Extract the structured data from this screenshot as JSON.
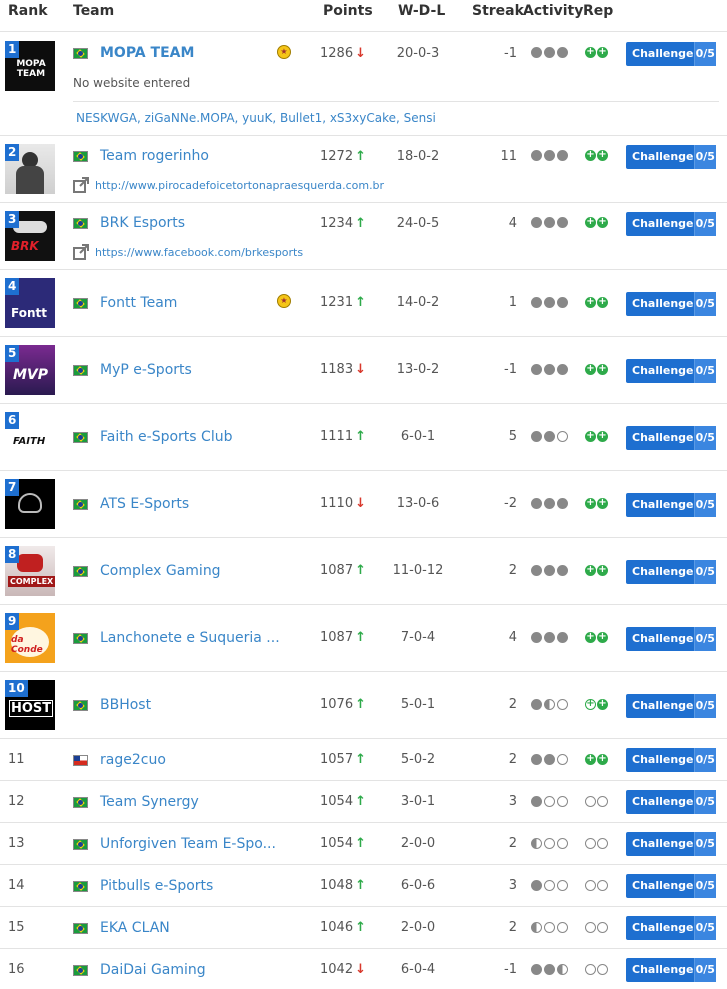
{
  "header": {
    "rank": "Rank",
    "team": "Team",
    "points": "Points",
    "wdl": "W-D-L",
    "streak": "Streak",
    "activity": "Activity",
    "rep": "Rep"
  },
  "challenge": {
    "label": "Challenge",
    "slots": "0/5"
  },
  "teams": [
    {
      "rank": "1",
      "name": "MOPA TEAM",
      "points": "1286",
      "trend": "down",
      "wdl": "20-0-3",
      "streak": "-1",
      "sub": "No website entered",
      "members": "NESKWGA, ziGaNNe.MOPA, yuuK, Bullet1, xS3xyCake, Sensi",
      "medal": true,
      "logo": "MOPA TEAM"
    },
    {
      "rank": "2",
      "name": "Team rogerinho",
      "points": "1272",
      "trend": "up",
      "wdl": "18-0-2",
      "streak": "11",
      "link": "http://www.pirocadefoicetortonapraesquerda.com.br"
    },
    {
      "rank": "3",
      "name": "BRK Esports",
      "points": "1234",
      "trend": "up",
      "wdl": "24-0-5",
      "streak": "4",
      "link": "https://www.facebook.com/brkesports",
      "logo": "BRK"
    },
    {
      "rank": "4",
      "name": "Fontt Team",
      "points": "1231",
      "trend": "up",
      "wdl": "14-0-2",
      "streak": "1",
      "medal": true,
      "logo": "Fontt"
    },
    {
      "rank": "5",
      "name": "MyP e-Sports",
      "points": "1183",
      "trend": "down",
      "wdl": "13-0-2",
      "streak": "-1",
      "logo": "MVP"
    },
    {
      "rank": "6",
      "name": "Faith e-Sports Club",
      "points": "1111",
      "trend": "up",
      "wdl": "6-0-1",
      "streak": "5",
      "logo": "FAITH"
    },
    {
      "rank": "7",
      "name": "ATS E-Sports",
      "points": "1110",
      "trend": "down",
      "wdl": "13-0-6",
      "streak": "-2"
    },
    {
      "rank": "8",
      "name": "Complex Gaming",
      "points": "1087",
      "trend": "up",
      "wdl": "11-0-12",
      "streak": "2",
      "logo": "COMPLEX"
    },
    {
      "rank": "9",
      "name": "Lanchonete e Suqueria ...",
      "points": "1087",
      "trend": "up",
      "wdl": "7-0-4",
      "streak": "4",
      "logo": "da Conde"
    },
    {
      "rank": "10",
      "name": "BBHost",
      "points": "1076",
      "trend": "up",
      "wdl": "5-0-1",
      "streak": "2",
      "logo": "HOST"
    },
    {
      "rank": "11",
      "name": "rage2cuo",
      "points": "1057",
      "trend": "up",
      "wdl": "5-0-2",
      "streak": "2"
    },
    {
      "rank": "12",
      "name": "Team Synergy",
      "points": "1054",
      "trend": "up",
      "wdl": "3-0-1",
      "streak": "3"
    },
    {
      "rank": "13",
      "name": "Unforgiven Team E-Spo...",
      "points": "1054",
      "trend": "up",
      "wdl": "2-0-0",
      "streak": "2"
    },
    {
      "rank": "14",
      "name": "Pitbulls e-Sports",
      "points": "1048",
      "trend": "up",
      "wdl": "6-0-6",
      "streak": "3"
    },
    {
      "rank": "15",
      "name": "EKA CLAN",
      "points": "1046",
      "trend": "up",
      "wdl": "2-0-0",
      "streak": "2"
    },
    {
      "rank": "16",
      "name": "DaiDai Gaming",
      "points": "1042",
      "trend": "down",
      "wdl": "6-0-4",
      "streak": "-1"
    }
  ],
  "icons": {
    "trend_up": "arrow-up-icon",
    "trend_down": "arrow-down-icon",
    "external_link": "external-link-icon",
    "medal": "medal-icon",
    "plus": "plus-icon"
  },
  "colors": {
    "accent": "#1e6fd0",
    "link": "#3a86c8",
    "up": "#2eaa4a",
    "down": "#d8382c"
  }
}
